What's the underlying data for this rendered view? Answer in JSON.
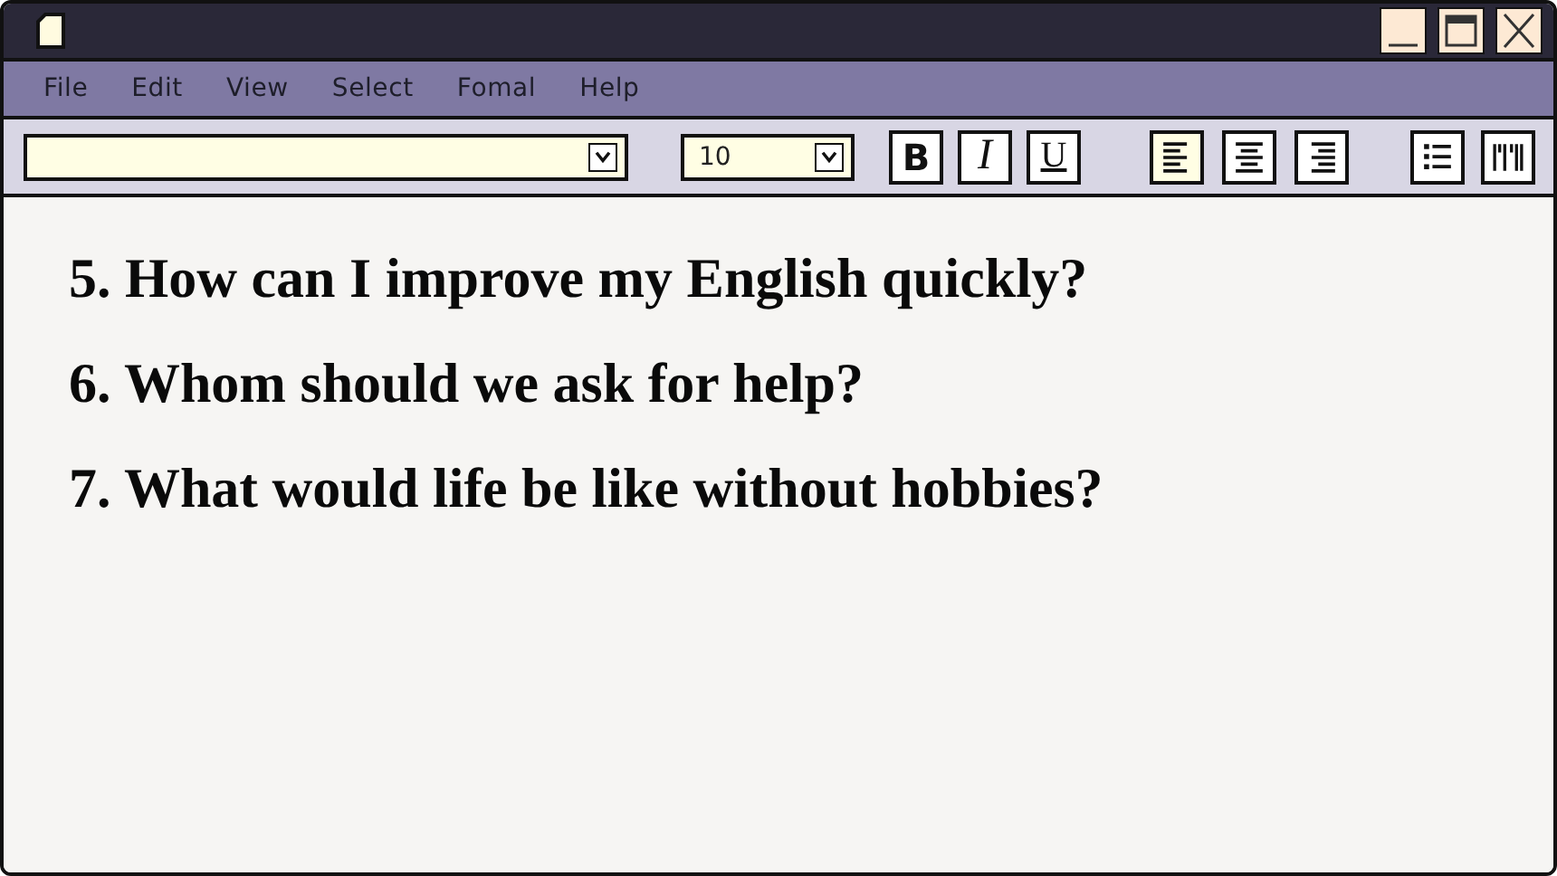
{
  "menu": [
    "File",
    "Edit",
    "View",
    "Select",
    "Fomal",
    "Help"
  ],
  "toolbar": {
    "size_field": {
      "value": "10"
    },
    "format_buttons": [
      {
        "kind": "bold",
        "label": "B",
        "on": false
      },
      {
        "kind": "italic",
        "label": "I",
        "on": false
      },
      {
        "kind": "underline",
        "label": "U",
        "on": false
      }
    ],
    "align_buttons": [
      {
        "kind": "left",
        "selected": true
      },
      {
        "kind": "center",
        "selected": false
      },
      {
        "kind": "right",
        "selected": false
      }
    ]
  },
  "document": {
    "lines": [
      "5. How can I improve my English quickly?",
      "6. Whom should we ask for help?",
      "7. What would life be like without hobbies?"
    ]
  }
}
